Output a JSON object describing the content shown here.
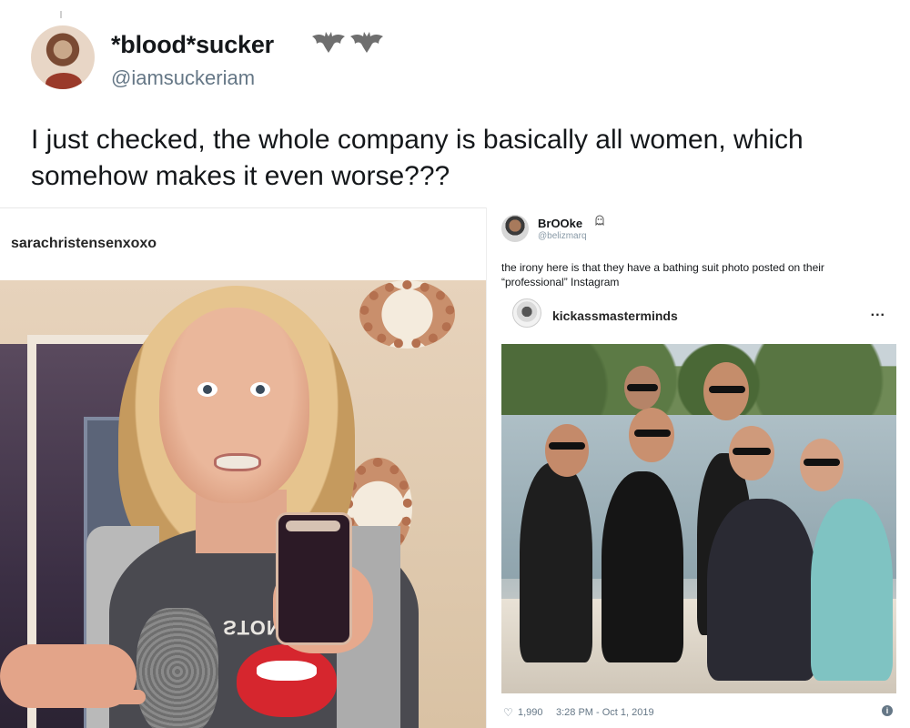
{
  "top_tweet": {
    "display_name": "*blood*sucker",
    "handle": "@iamsuckeriam",
    "text": "I just checked, the whole company is basically all women, which somehow makes it even worse???",
    "name_icons": [
      "bat-icon",
      "bat-icon"
    ]
  },
  "left_post": {
    "username": "sarachristensenxoxo",
    "shirt_print": "STONES"
  },
  "right_tweet": {
    "display_name": "BrOOke",
    "name_icon": "ghost-icon",
    "handle": "@belizmarq",
    "text": "the irony here is that they have a bathing suit photo posted on their “professional” Instagram",
    "embed": {
      "username": "kickassmasterminds",
      "more_label": "...",
      "likes": "1,990",
      "timestamp": "3:28 PM - Oct 1, 2019",
      "info_label": "i"
    }
  }
}
